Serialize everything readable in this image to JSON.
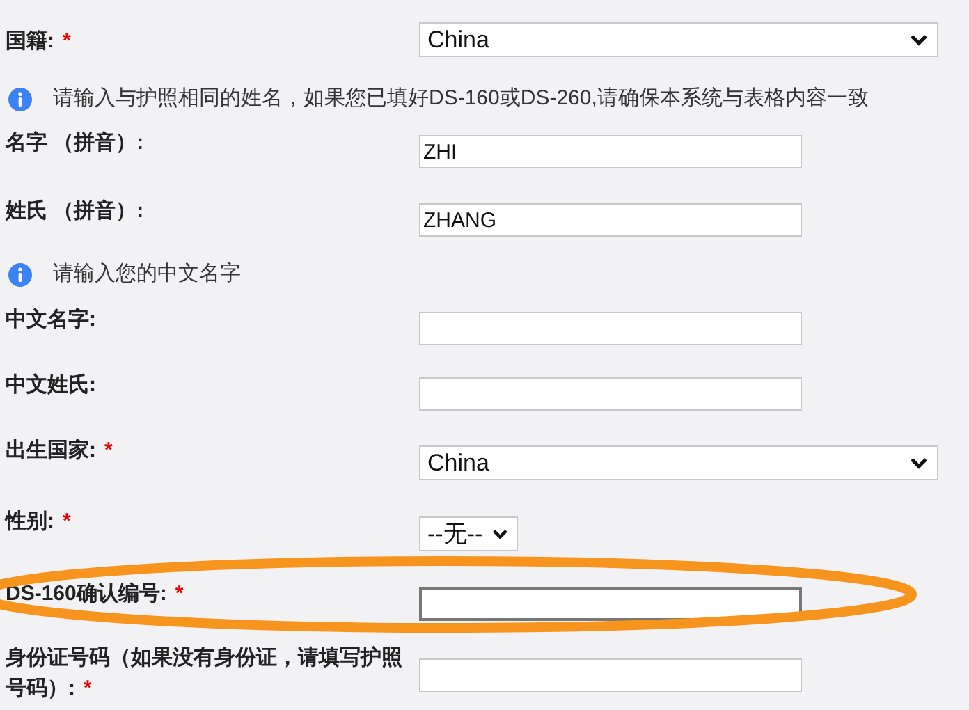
{
  "form": [
    {
      "kind": "select",
      "label": "国籍:",
      "asterisk": "*",
      "value": "China",
      "highlighted": false
    },
    {
      "kind": "info",
      "text": "请输入与护照相同的姓名，如果您已填好DS-160或DS-260,请确保本系统与表格内容一致"
    },
    {
      "kind": "text",
      "label": "名字 （拼音）:",
      "value": "ZHI",
      "highlighted": false
    },
    {
      "kind": "text",
      "label": "姓氏 （拼音）:",
      "value": "ZHANG",
      "highlighted": false
    },
    {
      "kind": "info",
      "text": "请输入您的中文名字"
    },
    {
      "kind": "text",
      "label": "中文名字:",
      "highlighted": false
    },
    {
      "kind": "text",
      "label": "中文姓氏:",
      "highlighted": false
    },
    {
      "kind": "select",
      "label": "出生国家:",
      "asterisk": "*",
      "value": "China",
      "highlighted": false
    },
    {
      "kind": "small-select",
      "label": "性别:",
      "asterisk": "*",
      "value": "--无--",
      "highlighted": false
    },
    {
      "kind": "text",
      "label": "DS-160确认编号:",
      "asterisk": "*",
      "highlighted": true
    },
    {
      "kind": "text",
      "label": "身份证号码（如果没有身份证，请填写护照号码）:",
      "asterisk": "*",
      "highlighted": false
    }
  ]
}
